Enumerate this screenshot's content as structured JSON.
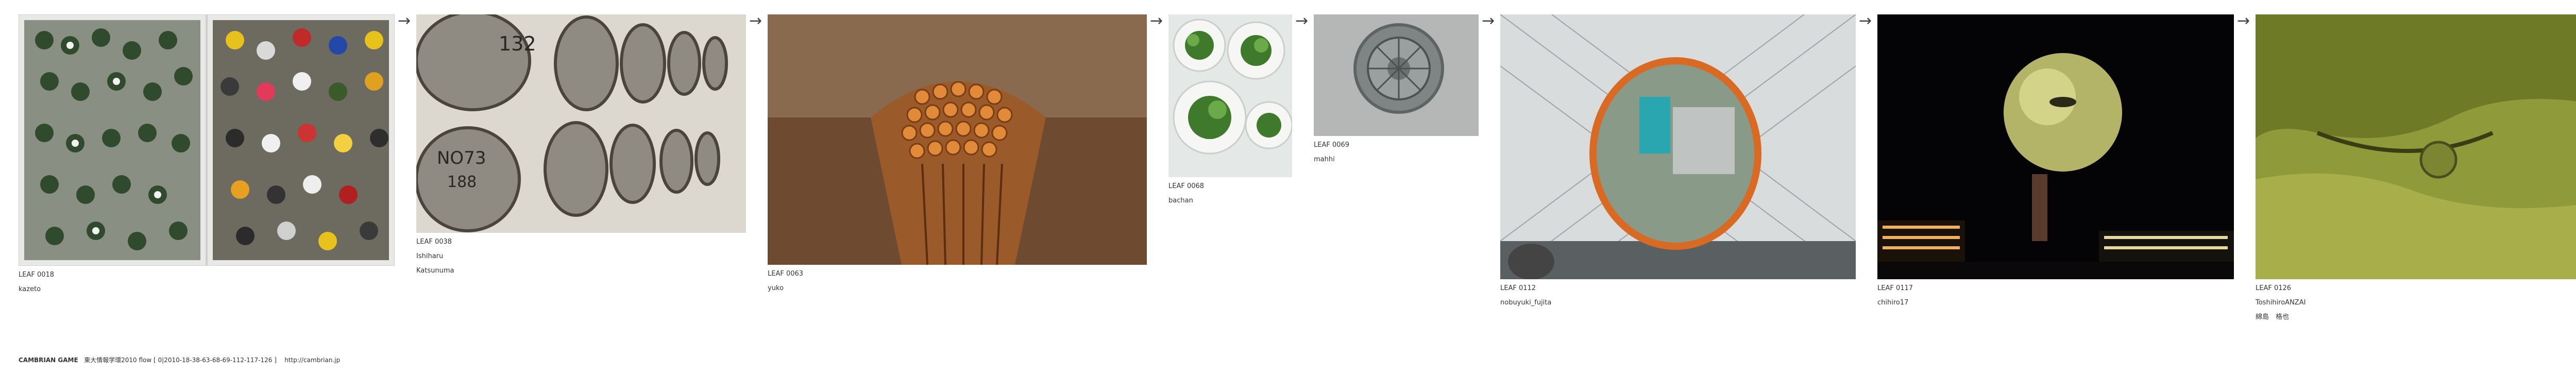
{
  "leaves": [
    {
      "label": "LEAF 0018",
      "authors": [
        "kazeto"
      ],
      "subject": "bottle-crates-photo"
    },
    {
      "label": "LEAF 0038",
      "authors": [
        "Ishiharu",
        "Katsunuma"
      ],
      "subject": "barrel-stack-photo"
    },
    {
      "label": "LEAF 0063",
      "authors": [
        "yuko"
      ],
      "subject": "chopsticks-bundle-photo"
    },
    {
      "label": "LEAF 0068",
      "authors": [
        "bachan"
      ],
      "subject": "potted-plants-photo"
    },
    {
      "label": "LEAF 0069",
      "authors": [
        "mahhi"
      ],
      "subject": "manhole-cover-photo"
    },
    {
      "label": "LEAF 0112",
      "authors": [
        "nobuyuki_fujita"
      ],
      "subject": "curved-mirror-photo"
    },
    {
      "label": "LEAF 0117",
      "authors": [
        "chihiro17"
      ],
      "subject": "night-globe-photo"
    },
    {
      "label": "LEAF 0126",
      "authors": [
        "ToshihiroANZAI",
        "綿島　格也"
      ],
      "subject": "green-surface-photo"
    }
  ],
  "arrow_glyph": "→",
  "footer": {
    "brand": "CAMBRIAN GAME",
    "text": "東大情報学環2010  flow [ 0|2010-18-38-63-68-69-112-117-126 ]",
    "url": "http://cambrian.jp"
  }
}
